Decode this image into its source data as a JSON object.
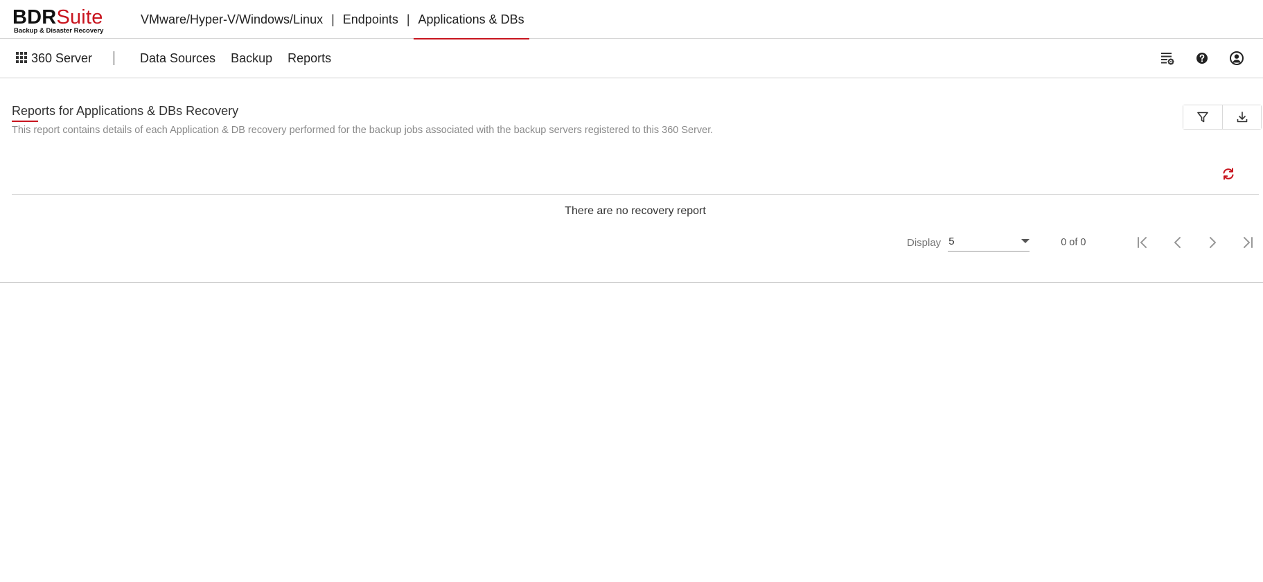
{
  "logo": {
    "brand_main": "BDR",
    "brand_accent": "Suite",
    "tagline": "Backup & Disaster Recovery"
  },
  "product_nav": {
    "items": [
      {
        "label": "VMware/Hyper-V/Windows/Linux"
      },
      {
        "label": "Endpoints"
      },
      {
        "label": "Applications & DBs",
        "active": true
      }
    ],
    "separator": "|"
  },
  "subbar": {
    "server_label": "360 Server",
    "nav": [
      {
        "label": "Data Sources"
      },
      {
        "label": "Backup"
      },
      {
        "label": "Reports"
      }
    ],
    "icons": [
      "settings-list-icon",
      "help-icon",
      "user-account-icon"
    ]
  },
  "page": {
    "title": "Reports for Applications & DBs Recovery",
    "description": "This report contains details of each Application & DB recovery performed for the backup jobs associated with the backup servers registered to this 360 Server.",
    "empty_message": "There are no recovery report"
  },
  "pagination": {
    "display_label": "Display",
    "page_size": "5",
    "count_text": "0 of 0"
  },
  "colors": {
    "accent": "#c8141e",
    "text": "#222222",
    "muted": "#8a8a8a",
    "border": "#d6d6d6"
  }
}
